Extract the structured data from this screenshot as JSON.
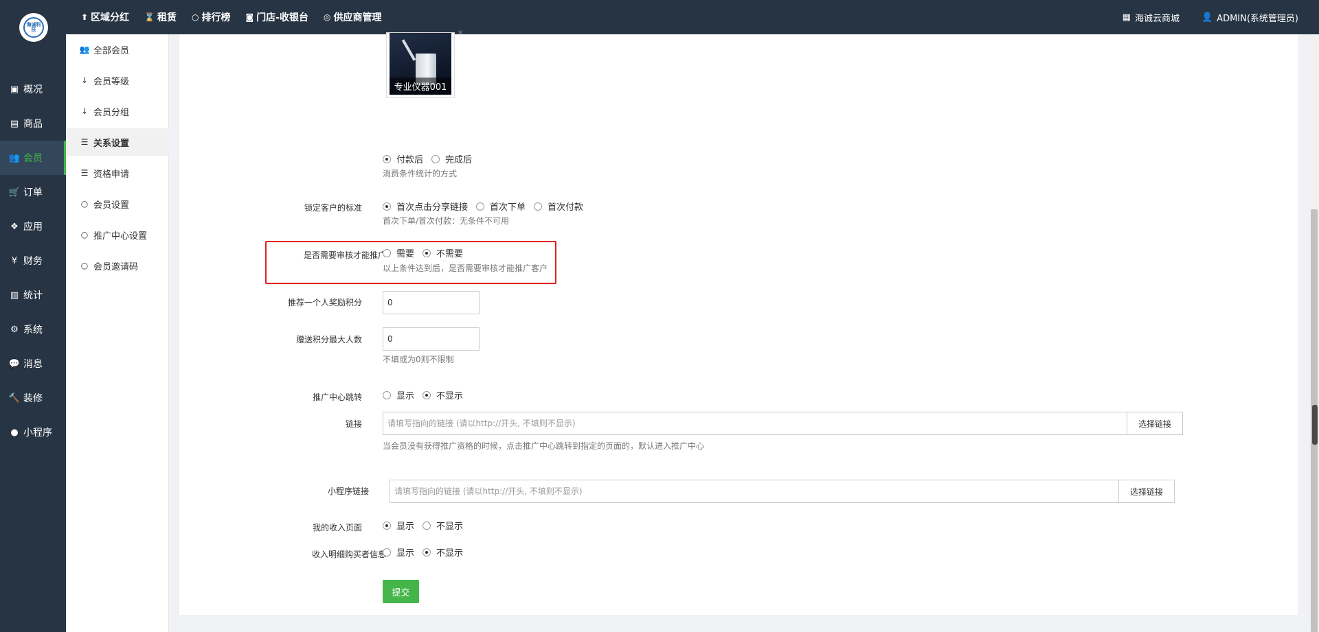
{
  "topnav": {
    "items": [
      {
        "label": "区域分红",
        "icon": "pin-icon"
      },
      {
        "label": "租赁",
        "icon": "hourglass-icon"
      },
      {
        "label": "排行榜",
        "icon": "circle-icon"
      },
      {
        "label": "门店-收银台",
        "icon": "camera-icon"
      },
      {
        "label": "供应商管理",
        "icon": "skype-icon"
      }
    ],
    "shop_label": "海诚云商城",
    "user_label": "ADMIN(系统管理员)"
  },
  "logo_text": "海诚科技",
  "sidebar": {
    "items": [
      {
        "label": "概况",
        "icon": "dashboard-icon"
      },
      {
        "label": "商品",
        "icon": "box-icon"
      },
      {
        "label": "会员",
        "icon": "users-icon",
        "active": true
      },
      {
        "label": "订单",
        "icon": "cart-icon"
      },
      {
        "label": "应用",
        "icon": "cubes-icon"
      },
      {
        "label": "财务",
        "icon": "yen-icon"
      },
      {
        "label": "统计",
        "icon": "bar-chart-icon"
      },
      {
        "label": "系统",
        "icon": "gears-icon"
      },
      {
        "label": "消息",
        "icon": "comment-icon"
      },
      {
        "label": "装修",
        "icon": "gavel-icon"
      },
      {
        "label": "小程序",
        "icon": "wechat-icon"
      }
    ],
    "active_color": "#44b549"
  },
  "subsidebar": {
    "items": [
      {
        "label": "全部会员",
        "icon": "users-icon"
      },
      {
        "label": "会员等级",
        "icon": "sort-amount-icon"
      },
      {
        "label": "会员分组",
        "icon": "sort-alpha-icon"
      },
      {
        "label": "关系设置",
        "icon": "sliders-icon",
        "active": true
      },
      {
        "label": "资格申请",
        "icon": "sliders-icon"
      },
      {
        "label": "会员设置",
        "icon": "circle-o-icon"
      },
      {
        "label": "推广中心设置",
        "icon": "circle-o-icon"
      },
      {
        "label": "会员邀请码",
        "icon": "circle-o-icon"
      }
    ]
  },
  "form": {
    "product_thumb_caption": "专业仪器001",
    "consume_stat": {
      "options": [
        "付款后",
        "完成后"
      ],
      "selected": 0,
      "help": "消费条件统计的方式"
    },
    "lock_standard": {
      "label": "锁定客户的标准",
      "options": [
        "首次点击分享链接",
        "首次下单",
        "首次付款"
      ],
      "selected": 0,
      "help": "首次下单/首次付款：无条件不可用"
    },
    "need_review": {
      "label": "是否需要审核才能推广",
      "options": [
        "需要",
        "不需要"
      ],
      "selected": 1,
      "help": "以上条件达到后，是否需要审核才能推广客户"
    },
    "reward_points": {
      "label": "推荐一个人奖励积分",
      "value": "0"
    },
    "max_people": {
      "label": "赠送积分最大人数",
      "value": "0",
      "help": "不填或为0则不限制"
    },
    "center_jump": {
      "label": "推广中心跳转",
      "options": [
        "显示",
        "不显示"
      ],
      "selected": 1
    },
    "link": {
      "label": "链接",
      "placeholder": "请填写指向的链接 (请以http://开头, 不填则不显示)",
      "button": "选择链接",
      "help": "当会员没有获得推广资格的时候，点击推广中心跳转到指定的页面的，默认进入推广中心"
    },
    "mini_link": {
      "label": "小程序链接",
      "placeholder": "请填写指向的链接 (请以http://开头, 不填则不显示)",
      "button": "选择链接"
    },
    "income_page": {
      "label": "我的收入页面",
      "options": [
        "显示",
        "不显示"
      ],
      "selected": 0
    },
    "buyer_info": {
      "label": "收入明细购买者信息",
      "options": [
        "显示",
        "不显示"
      ],
      "selected": 1
    },
    "submit_label": "提交"
  }
}
